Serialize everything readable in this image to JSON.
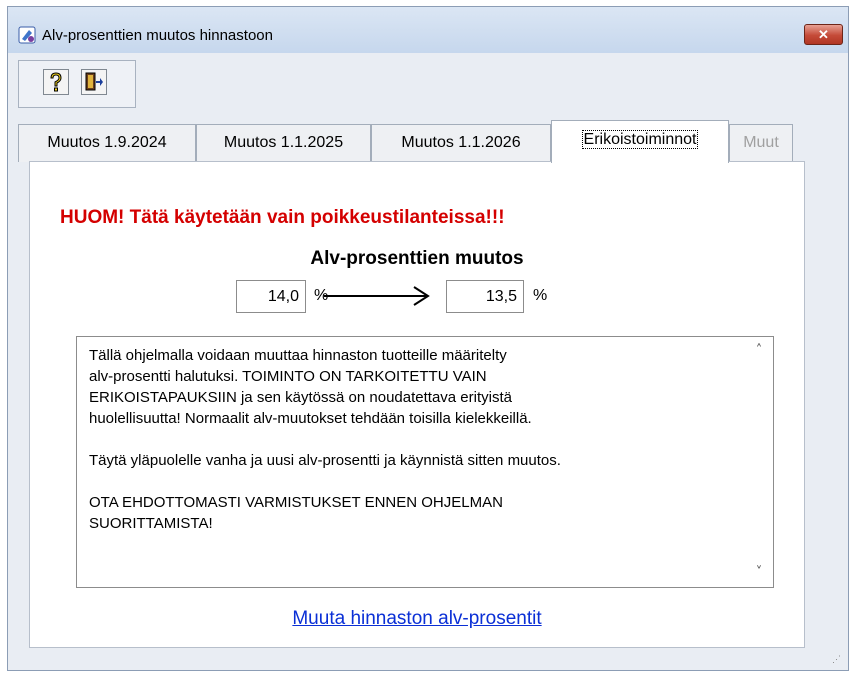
{
  "window": {
    "title": "Alv-prosenttien muutos hinnastoon",
    "close_symbol": "✕"
  },
  "toolbar": {
    "help_icon": "help-icon",
    "exit_icon": "exit-door-icon"
  },
  "tabs": [
    {
      "label": "Muutos 1.9.2024",
      "active": false,
      "enabled": true
    },
    {
      "label": "Muutos 1.1.2025",
      "active": false,
      "enabled": true
    },
    {
      "label": "Muutos 1.1.2026",
      "active": false,
      "enabled": true
    },
    {
      "label": "Erikoistoiminnot",
      "active": true,
      "enabled": true
    },
    {
      "label": "Muut",
      "active": false,
      "enabled": false
    }
  ],
  "panel": {
    "warning": "HUOM! Tätä käytetään vain poikkeustilanteissa!!!",
    "heading": "Alv-prosenttien muutos",
    "old_rate": "14,0",
    "new_rate": "13,5",
    "percent_sign": "%",
    "info_text": "Tällä ohjelmalla voidaan muuttaa hinnaston tuotteille määritelty\nalv-prosentti halutuksi. TOIMINTO ON TARKOITETTU VAIN\nERIKOISTAPAUKSIIN ja sen käytössä on noudatettava erityistä\nhuolellisuutta! Normaalit alv-muutokset tehdään toisilla kielekkeillä.\n\nTäytä yläpuolelle vanha ja uusi alv-prosentti ja käynnistä sitten muutos.\n\nOTA EHDOTTOMASTI VARMISTUKSET ENNEN OHJELMAN\nSUORITTAMISTA!",
    "action_link": "Muuta hinnaston alv-prosentit"
  },
  "colors": {
    "warning": "#d40000",
    "link": "#0a2fd6",
    "close_button": "#c44a38"
  }
}
